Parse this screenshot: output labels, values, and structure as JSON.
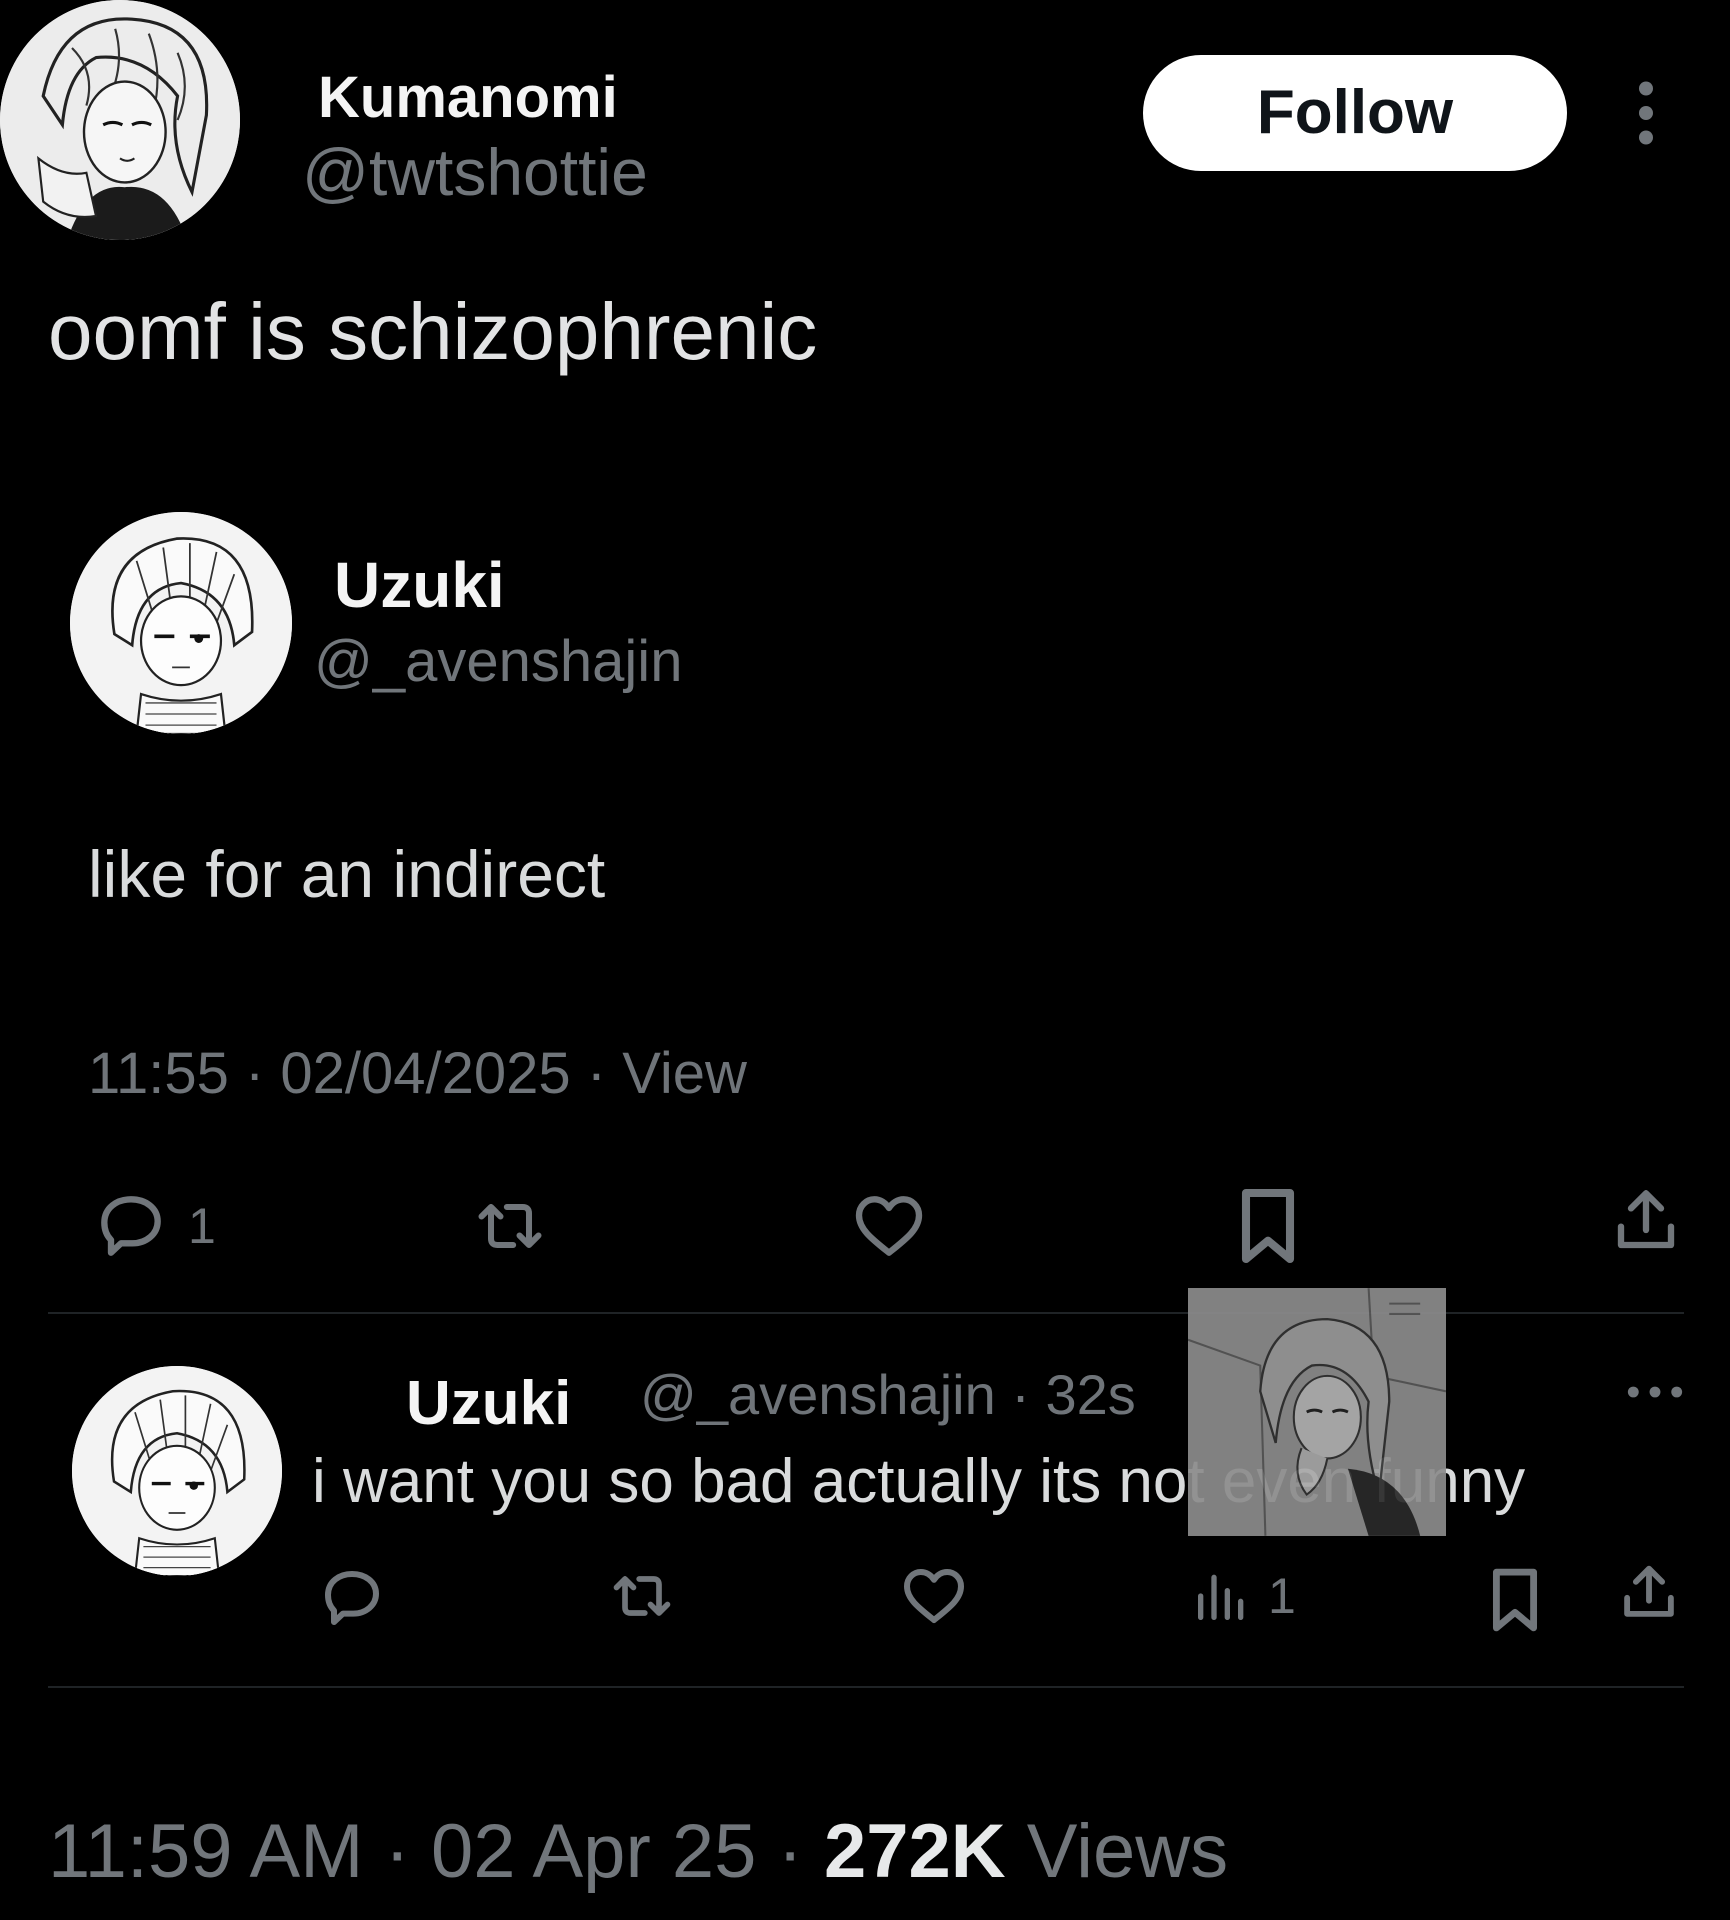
{
  "header": {
    "display_name": "Kumanomi",
    "handle": "@twtshottie",
    "follow_label": "Follow",
    "more_icon": "more-vertical-icon"
  },
  "tweet": {
    "text": "oomf is schizophrenic"
  },
  "quoted_tweet": {
    "display_name": "Uzuki",
    "handle": "@_avenshajin",
    "text": "like for an indirect",
    "meta": "11:55 · 02/04/2025 · View",
    "reply_count": "1",
    "icons": [
      "reply-icon",
      "retweet-icon",
      "like-icon",
      "bookmark-icon",
      "share-icon"
    ]
  },
  "reply": {
    "display_name": "Uzuki",
    "handle_time": "@_avenshajin · 32s",
    "text": "i want you so bad actually its not even funny",
    "views_count": "1",
    "more_icon": "more-horizontal-icon"
  },
  "footer": {
    "time": "11:59 AM",
    "date": "02 Apr 25",
    "separator": "·",
    "views_count": "272K",
    "views_label": "Views"
  },
  "colors": {
    "background": "#000000",
    "text": "#e7e9ea",
    "muted": "#71767b",
    "button": "#ffffff"
  }
}
